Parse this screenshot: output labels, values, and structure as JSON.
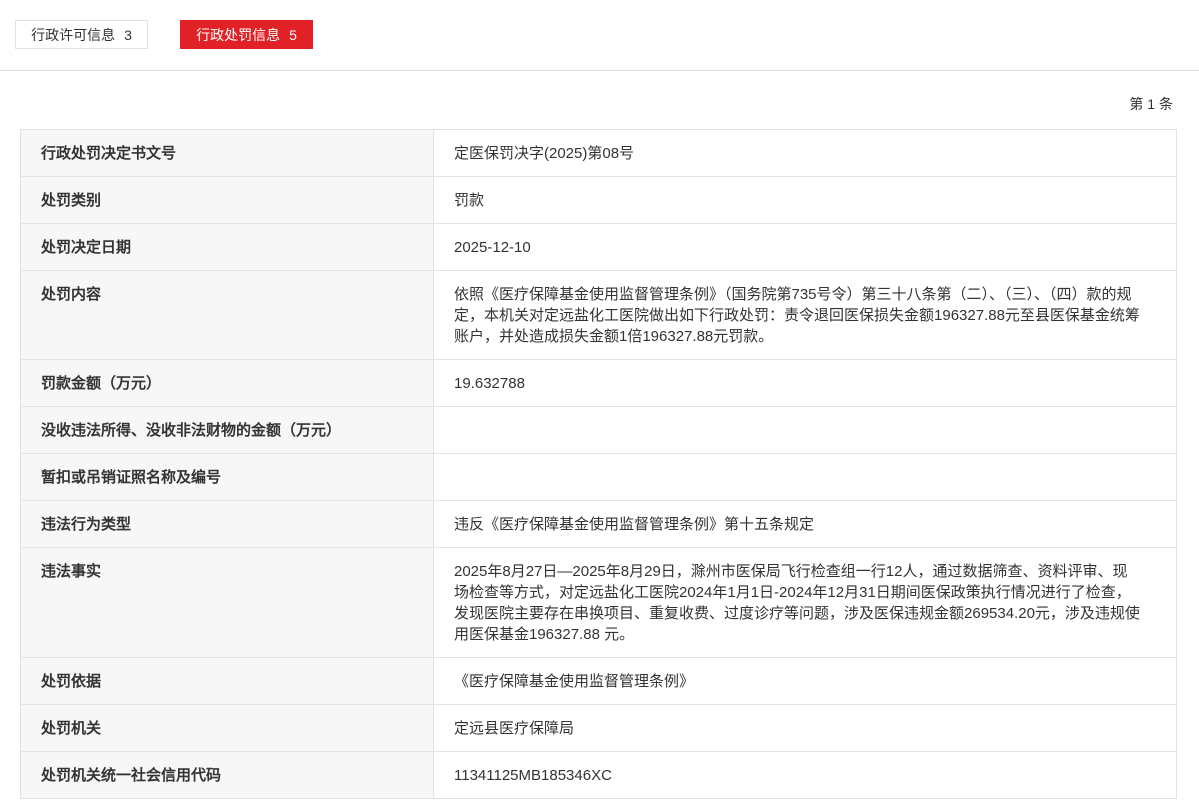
{
  "tabs": [
    {
      "label": "行政许可信息",
      "count": "3",
      "active": false
    },
    {
      "label": "行政处罚信息",
      "count": "5",
      "active": true
    }
  ],
  "page_indicator": "第 1 条",
  "rows": [
    {
      "label": "行政处罚决定书文号",
      "value": "定医保罚决字(2025)第08号"
    },
    {
      "label": "处罚类别",
      "value": "罚款"
    },
    {
      "label": "处罚决定日期",
      "value": "2025-12-10"
    },
    {
      "label": "处罚内容",
      "value": "依照《医疗保障基金使用监督管理条例》（国务院第735号令）第三十八条第（二）、（三）、（四）款的规定，本机关对定远盐化工医院做出如下行政处罚：责令退回医保损失金额196327.88元至县医保基金统筹账户，并处造成损失金额1倍196327.88元罚款。"
    },
    {
      "label": "罚款金额（万元）",
      "value": "19.632788"
    },
    {
      "label": "没收违法所得、没收非法财物的金额（万元）",
      "value": ""
    },
    {
      "label": "暂扣或吊销证照名称及编号",
      "value": ""
    },
    {
      "label": "违法行为类型",
      "value": "违反《医疗保障基金使用监督管理条例》第十五条规定"
    },
    {
      "label": "违法事实",
      "value": "2025年8月27日—2025年8月29日，滁州市医保局飞行检查组一行12人，通过数据筛查、资料评审、现场检查等方式，对定远盐化工医院2024年1月1日-2024年12月31日期间医保政策执行情况进行了检查，发现医院主要存在串换项目、重复收费、过度诊疗等问题，涉及医保违规金额269534.20元，涉及违规使用医保基金196327.88 元。"
    },
    {
      "label": "处罚依据",
      "value": "《医疗保障基金使用监督管理条例》"
    },
    {
      "label": "处罚机关",
      "value": "定远县医疗保障局"
    },
    {
      "label": "处罚机关统一社会信用代码",
      "value": "11341125MB185346XC"
    }
  ]
}
